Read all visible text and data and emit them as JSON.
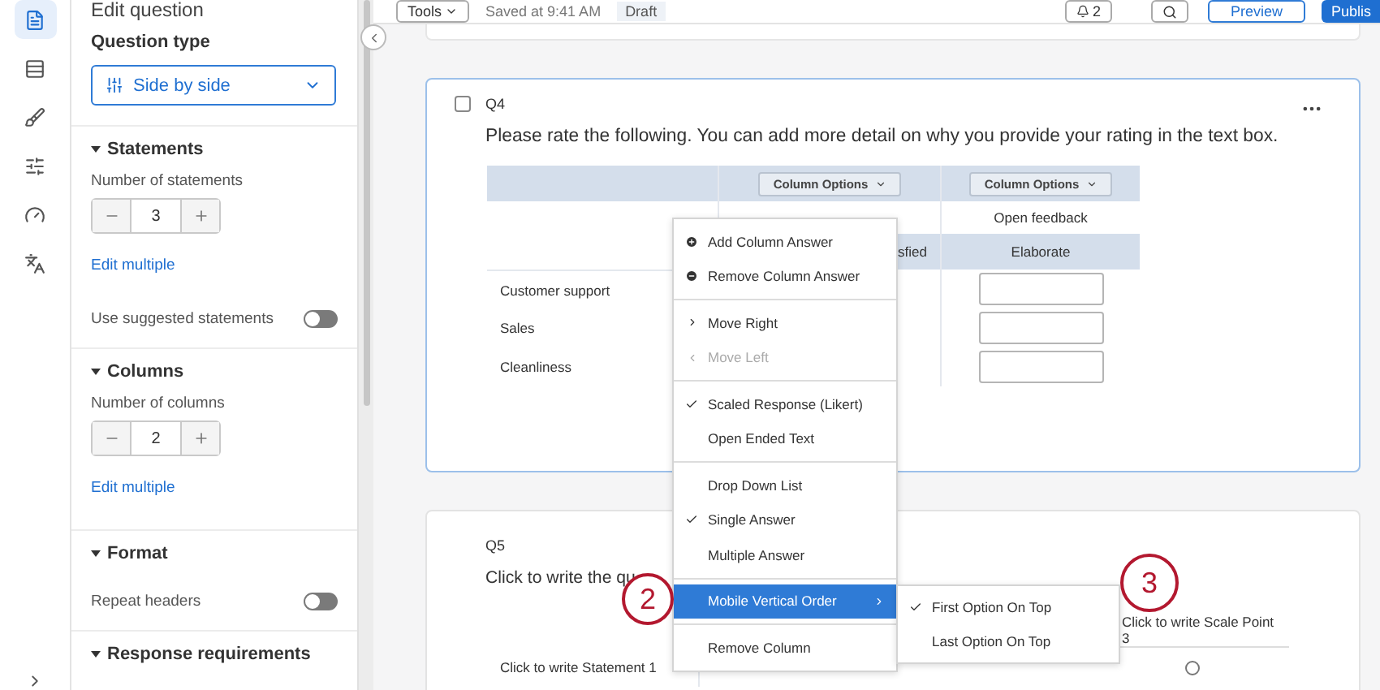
{
  "top_bar": {
    "tools_button": "Tools",
    "saved_status": "Saved at 9:41 AM",
    "draft_badge": "Draft",
    "notifications_count": "2",
    "preview_button": "Preview",
    "publish_button": "Publis"
  },
  "icon_rail": [
    {
      "selected": true
    },
    {
      "selected": false
    },
    {
      "selected": false
    },
    {
      "selected": false
    },
    {
      "selected": false
    },
    {
      "selected": false
    }
  ],
  "sidebar": {
    "title": "Edit question",
    "question_type": {
      "label": "Question type",
      "value": "Side by side"
    },
    "sections": [
      {
        "title": "Statements",
        "expanded": true,
        "rows": [
          {
            "kind": "stepper",
            "label": "Number of statements",
            "value": "3"
          },
          {
            "kind": "link",
            "text": "Edit multiple"
          },
          {
            "kind": "toggle",
            "label": "Use suggested statements",
            "on": false
          }
        ]
      },
      {
        "title": "Columns",
        "expanded": true,
        "rows": [
          {
            "kind": "stepper",
            "label": "Number of columns",
            "value": "2"
          },
          {
            "kind": "link",
            "text": "Edit multiple"
          }
        ]
      },
      {
        "title": "Format",
        "expanded": true,
        "rows": [
          {
            "kind": "toggle",
            "label": "Repeat headers",
            "on": false
          }
        ]
      },
      {
        "title": "Response requirements",
        "expanded": true
      }
    ]
  },
  "q4": {
    "number": "Q4",
    "selected": true,
    "checked": false,
    "text": "Please rate the following. You can add more detail on why you provide your rating in the text box.",
    "column_buttons": [
      "Column Options",
      "Column Options"
    ],
    "header_rows": [
      [
        "",
        "Open feedback"
      ],
      [
        "sfied",
        "Elaborate"
      ]
    ],
    "statements": [
      "Customer support",
      "Sales",
      "Cleanliness"
    ]
  },
  "q5": {
    "number": "Q5",
    "text": "Click to write the qu",
    "scale_header": "Click to write Scale Point 3",
    "statements": [
      {
        "label": "Click to write Statement 1",
        "checked": false
      }
    ]
  },
  "menu": {
    "groups": [
      [
        {
          "label": "Add Column Answer",
          "kind": "add",
          "disabled": false,
          "selected": false
        },
        {
          "label": "Remove Column Answer",
          "kind": "remove",
          "disabled": false,
          "selected": false
        }
      ],
      [
        {
          "label": "Move Right",
          "kind": "move_right",
          "disabled": false,
          "selected": false
        },
        {
          "label": "Move Left",
          "kind": "move_left",
          "disabled": true,
          "selected": false
        }
      ],
      [
        {
          "label": "Scaled Response (Likert)",
          "kind": "option",
          "checked": true,
          "disabled": false,
          "selected": false
        },
        {
          "label": "Open Ended Text",
          "kind": "option",
          "checked": false,
          "disabled": false,
          "selected": false
        }
      ],
      [
        {
          "label": "Drop Down List",
          "kind": "option",
          "checked": false,
          "disabled": false,
          "selected": false
        },
        {
          "label": "Single Answer",
          "kind": "option",
          "checked": true,
          "disabled": false,
          "selected": false
        },
        {
          "label": "Multiple Answer",
          "kind": "option",
          "checked": false,
          "disabled": false,
          "selected": false
        }
      ],
      [
        {
          "label": "Mobile Vertical Order",
          "kind": "submenu",
          "disabled": false,
          "selected": true
        }
      ],
      [
        {
          "label": "Remove Column",
          "kind": "action",
          "disabled": false,
          "selected": false
        }
      ]
    ],
    "submenu": [
      {
        "label": "First Option On Top",
        "checked": true
      },
      {
        "label": "Last Option On Top",
        "checked": false
      }
    ]
  },
  "markers": [
    {
      "label": "2"
    },
    {
      "label": "3"
    }
  ]
}
